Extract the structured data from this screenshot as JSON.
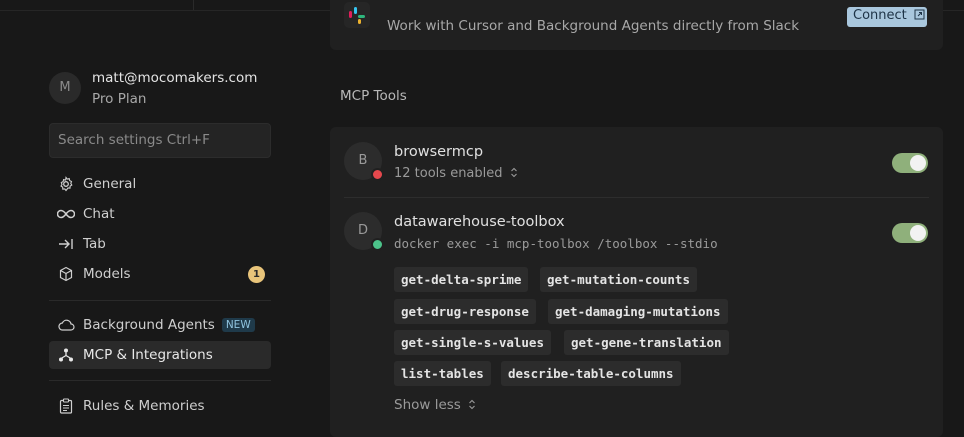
{
  "account": {
    "avatar_letter": "M",
    "email": "matt@mocomakers.com",
    "plan": "Pro Plan"
  },
  "search": {
    "placeholder": "Search settings Ctrl+F"
  },
  "nav": {
    "general": "General",
    "chat": "Chat",
    "tab": "Tab",
    "models": "Models",
    "models_badge": "1",
    "background_agents": "Background Agents",
    "background_agents_badge": "NEW",
    "mcp": "MCP & Integrations",
    "rules": "Rules & Memories"
  },
  "slack": {
    "description": "Work with Cursor and Background Agents directly from Slack",
    "connect_label": "Connect"
  },
  "mcp_section": {
    "title": "MCP Tools",
    "servers": [
      {
        "letter": "B",
        "name": "browsermcp",
        "subtitle": "12 tools enabled",
        "status_color": "#e5484d",
        "enabled": true
      },
      {
        "letter": "D",
        "name": "datawarehouse-toolbox",
        "command": "docker exec -i mcp-toolbox /toolbox --stdio",
        "status_color": "#4cc38a",
        "enabled": true,
        "tools": [
          "get-delta-sprime",
          "get-mutation-counts",
          "get-drug-response",
          "get-damaging-mutations",
          "get-single-s-values",
          "get-gene-translation",
          "list-tables",
          "describe-table-columns"
        ],
        "show_less_label": "Show less"
      }
    ]
  },
  "colors": {
    "background": "#181818",
    "card": "#202020",
    "toggle_on": "#8fb07b",
    "connect_button": "#a9c7dd",
    "badge_yellow": "#e8c47a"
  }
}
